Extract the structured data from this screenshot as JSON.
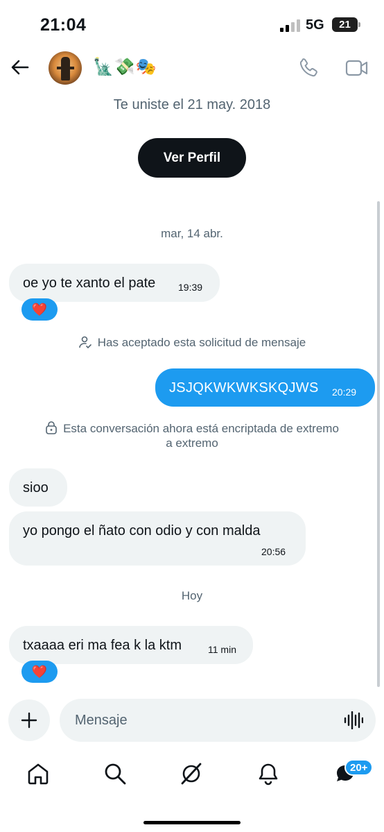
{
  "status": {
    "time": "21:04",
    "network": "5G",
    "battery": "21"
  },
  "header": {
    "emojis": "🗽💸🎭"
  },
  "profile": {
    "joined": "Te uniste el 21 may. 2018",
    "view_profile": "Ver Perfil"
  },
  "messages": {
    "date1": "mar, 14 abr.",
    "m1": {
      "text": "oe yo te xanto el pate",
      "time": "19:39",
      "reaction": "❤️"
    },
    "accepted": "Has aceptado esta solicitud de mensaje",
    "m2": {
      "text": "JSJQKWKWKSKQJWS",
      "time": "20:29"
    },
    "encrypted_line1": "Esta conversación ahora está encriptada de extremo",
    "encrypted_line2": "a extremo",
    "m3": {
      "text": "sioo"
    },
    "m4": {
      "text": "yo pongo el ñato con odio y con malda",
      "time": "20:56"
    },
    "date2": "Hoy",
    "m5": {
      "text": "txaaaa eri ma fea k la ktm",
      "time": "11 min",
      "reaction": "❤️"
    }
  },
  "composer": {
    "placeholder": "Mensaje"
  },
  "nav": {
    "messages_badge": "20+"
  },
  "colors": {
    "accent": "#1d9bf0",
    "bubble_in": "#eff3f4",
    "text_secondary": "#536471"
  }
}
